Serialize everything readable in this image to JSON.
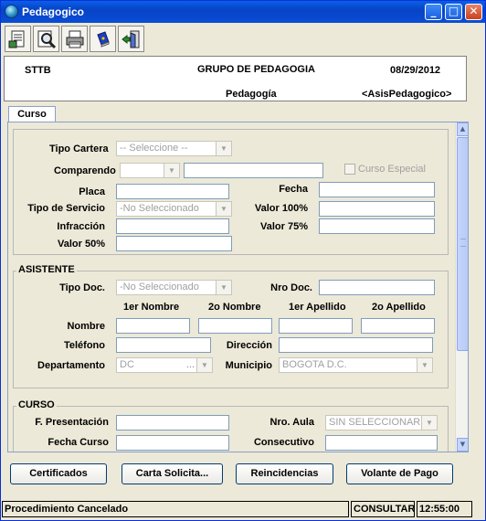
{
  "window": {
    "title": "Pedagogico",
    "minimize": "_",
    "maximize": "□",
    "close": "✕"
  },
  "toolbar": {
    "icons": [
      "form-document-icon",
      "search-magnifier-icon",
      "print-icon",
      "book-icon",
      "exit-door-icon"
    ]
  },
  "header": {
    "left": "STTB",
    "center_title": "GRUPO DE PEDAGOGIA",
    "date": "08/29/2012",
    "center_sub": "Pedagogía",
    "right_sub": "<AsisPedagogico>"
  },
  "tabs": [
    {
      "label": "Curso"
    }
  ],
  "form": {
    "tipo_cartera": {
      "label": "Tipo Cartera",
      "value": "-- Seleccione --"
    },
    "comparendo": {
      "label": "Comparendo",
      "value": ""
    },
    "curso_especial": {
      "label": "Curso Especial",
      "checked": false
    },
    "placa": {
      "label": "Placa",
      "value": ""
    },
    "fecha": {
      "label": "Fecha",
      "value": ""
    },
    "tipo_servicio": {
      "label": "Tipo de Servicio",
      "value": "-No Seleccionado"
    },
    "valor_100": {
      "label": "Valor 100%",
      "value": ""
    },
    "infraccion": {
      "label": "Infracción",
      "value": ""
    },
    "valor_75": {
      "label": "Valor 75%",
      "value": ""
    },
    "valor_50": {
      "label": "Valor 50%",
      "value": ""
    }
  },
  "asistente": {
    "title": "ASISTENTE",
    "tipo_doc": {
      "label": "Tipo Doc.",
      "value": "-No Seleccionado"
    },
    "nro_doc": {
      "label": "Nro Doc.",
      "value": ""
    },
    "col_headers": [
      "1er Nombre",
      "2o Nombre",
      "1er Apellido",
      "2o Apellido"
    ],
    "nombre": {
      "label": "Nombre"
    },
    "telefono": {
      "label": "Teléfono",
      "value": ""
    },
    "direccion": {
      "label": "Dirección",
      "value": ""
    },
    "departamento": {
      "label": "Departamento",
      "value": "DC"
    },
    "municipio": {
      "label": "Municipio",
      "value": "BOGOTA D.C."
    }
  },
  "curso": {
    "title": "CURSO",
    "f_presentacion": {
      "label": "F. Presentación",
      "value": ""
    },
    "nro_aula": {
      "label": "Nro. Aula",
      "value": "SIN SELECCIONAR"
    },
    "fecha_curso": {
      "label": "Fecha Curso",
      "value": ""
    },
    "consecutivo": {
      "label": "Consecutivo",
      "value": ""
    }
  },
  "buttons": {
    "certificados": "Certificados",
    "carta": "Carta Solicita...",
    "reincidencias": "Reincidencias",
    "volante": "Volante de Pago"
  },
  "status": {
    "message": "Procedimiento Cancelado",
    "mode": "CONSULTAR",
    "time": "12:55:00"
  }
}
